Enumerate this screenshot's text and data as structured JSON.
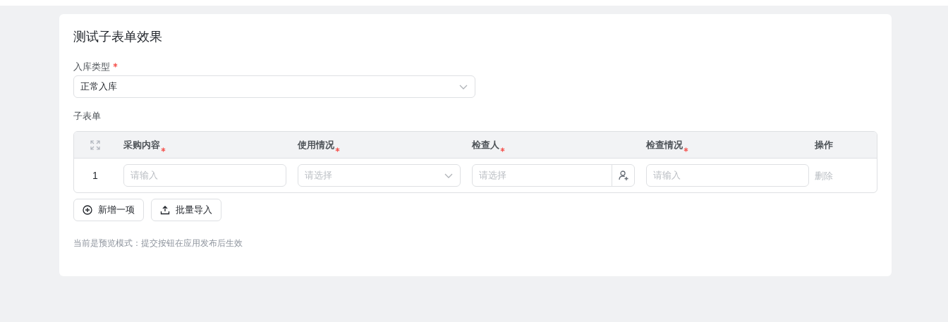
{
  "form": {
    "title": "测试子表单效果"
  },
  "stock_type": {
    "label": "入库类型",
    "required": true,
    "value": "正常入库"
  },
  "subform": {
    "label": "子表单",
    "columns": [
      {
        "label": "采购内容",
        "required": true
      },
      {
        "label": "使用情况",
        "required": true
      },
      {
        "label": "检查人",
        "required": true
      },
      {
        "label": "检查情况",
        "required": true
      }
    ],
    "action_column": "操作",
    "rows": [
      {
        "index": "1",
        "cells": [
          {
            "kind": "input",
            "placeholder": "请输入"
          },
          {
            "kind": "select",
            "placeholder": "请选择"
          },
          {
            "kind": "person",
            "placeholder": "请选择"
          },
          {
            "kind": "input",
            "placeholder": "请输入"
          }
        ],
        "action": "删除"
      }
    ]
  },
  "buttons": [
    {
      "kind": "add",
      "label": "新增一项"
    },
    {
      "kind": "import",
      "label": "批量导入"
    }
  ],
  "note": "当前是预览模式：提交按钮在应用发布后生效"
}
